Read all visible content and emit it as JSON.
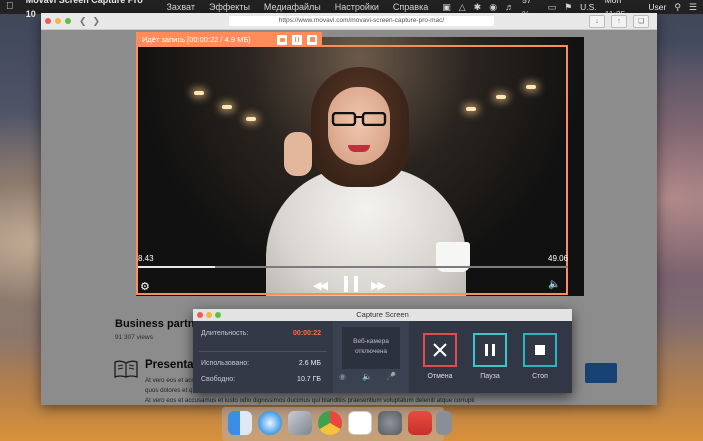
{
  "menubar": {
    "app_name": "Movavi Screen Capture Pro 10",
    "menus": [
      "Захват",
      "Эффекты",
      "Медиафайлы",
      "Настройки",
      "Справка"
    ],
    "battery": "57 %",
    "locale": "U.S.",
    "clock": "Mon 11:25",
    "user": "User"
  },
  "browser": {
    "url": "https://www.movavi.com/movavi-screen-capture-pro-mac/"
  },
  "recording": {
    "status": "Идёт запись [00:00:22 / 4.9 МБ]"
  },
  "player": {
    "time_current": "8.43",
    "time_total": "49.06",
    "progress": 0.18
  },
  "page": {
    "video_title": "Business partne",
    "views": "91 307 views",
    "section_title": "Presentat",
    "text_line1": "At vero eos et accu",
    "text_line2": "quos dolores et qu",
    "text_line3": "At vero eos et accusamus et iusto odio dignissimos ducimus qui blanditiis praesentium voluptatum deleniti atque corrupti"
  },
  "capture_panel": {
    "title": "Capture Screen",
    "duration_label": "Длительность:",
    "duration_value": "00:00:22",
    "used_label": "Использовано:",
    "used_value": "2.6 МБ",
    "free_label": "Свободно:",
    "free_value": "10.7 ГБ",
    "webcam_line1": "Веб-камера",
    "webcam_line2": "отключена",
    "cancel_label": "Отмена",
    "pause_label": "Пауза",
    "stop_label": "Стоп"
  },
  "colors": {
    "recording_accent": "#ff8c5a",
    "cancel_border": "#e04b4b",
    "pause_border": "#3ec3c8",
    "stop_border": "#2bb3c0",
    "duration_value": "#ff6a4a",
    "audio_icon": "#37c7c7"
  }
}
